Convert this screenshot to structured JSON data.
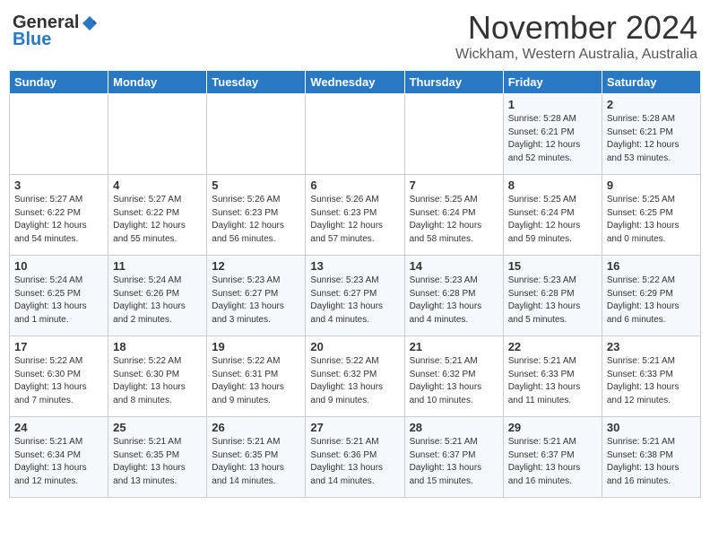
{
  "header": {
    "logo_general": "General",
    "logo_blue": "Blue",
    "title": "November 2024",
    "location": "Wickham, Western Australia, Australia"
  },
  "calendar": {
    "days_of_week": [
      "Sunday",
      "Monday",
      "Tuesday",
      "Wednesday",
      "Thursday",
      "Friday",
      "Saturday"
    ],
    "weeks": [
      [
        {
          "date": "",
          "info": ""
        },
        {
          "date": "",
          "info": ""
        },
        {
          "date": "",
          "info": ""
        },
        {
          "date": "",
          "info": ""
        },
        {
          "date": "",
          "info": ""
        },
        {
          "date": "1",
          "info": "Sunrise: 5:28 AM\nSunset: 6:21 PM\nDaylight: 12 hours\nand 52 minutes."
        },
        {
          "date": "2",
          "info": "Sunrise: 5:28 AM\nSunset: 6:21 PM\nDaylight: 12 hours\nand 53 minutes."
        }
      ],
      [
        {
          "date": "3",
          "info": "Sunrise: 5:27 AM\nSunset: 6:22 PM\nDaylight: 12 hours\nand 54 minutes."
        },
        {
          "date": "4",
          "info": "Sunrise: 5:27 AM\nSunset: 6:22 PM\nDaylight: 12 hours\nand 55 minutes."
        },
        {
          "date": "5",
          "info": "Sunrise: 5:26 AM\nSunset: 6:23 PM\nDaylight: 12 hours\nand 56 minutes."
        },
        {
          "date": "6",
          "info": "Sunrise: 5:26 AM\nSunset: 6:23 PM\nDaylight: 12 hours\nand 57 minutes."
        },
        {
          "date": "7",
          "info": "Sunrise: 5:25 AM\nSunset: 6:24 PM\nDaylight: 12 hours\nand 58 minutes."
        },
        {
          "date": "8",
          "info": "Sunrise: 5:25 AM\nSunset: 6:24 PM\nDaylight: 12 hours\nand 59 minutes."
        },
        {
          "date": "9",
          "info": "Sunrise: 5:25 AM\nSunset: 6:25 PM\nDaylight: 13 hours\nand 0 minutes."
        }
      ],
      [
        {
          "date": "10",
          "info": "Sunrise: 5:24 AM\nSunset: 6:25 PM\nDaylight: 13 hours\nand 1 minute."
        },
        {
          "date": "11",
          "info": "Sunrise: 5:24 AM\nSunset: 6:26 PM\nDaylight: 13 hours\nand 2 minutes."
        },
        {
          "date": "12",
          "info": "Sunrise: 5:23 AM\nSunset: 6:27 PM\nDaylight: 13 hours\nand 3 minutes."
        },
        {
          "date": "13",
          "info": "Sunrise: 5:23 AM\nSunset: 6:27 PM\nDaylight: 13 hours\nand 4 minutes."
        },
        {
          "date": "14",
          "info": "Sunrise: 5:23 AM\nSunset: 6:28 PM\nDaylight: 13 hours\nand 4 minutes."
        },
        {
          "date": "15",
          "info": "Sunrise: 5:23 AM\nSunset: 6:28 PM\nDaylight: 13 hours\nand 5 minutes."
        },
        {
          "date": "16",
          "info": "Sunrise: 5:22 AM\nSunset: 6:29 PM\nDaylight: 13 hours\nand 6 minutes."
        }
      ],
      [
        {
          "date": "17",
          "info": "Sunrise: 5:22 AM\nSunset: 6:30 PM\nDaylight: 13 hours\nand 7 minutes."
        },
        {
          "date": "18",
          "info": "Sunrise: 5:22 AM\nSunset: 6:30 PM\nDaylight: 13 hours\nand 8 minutes."
        },
        {
          "date": "19",
          "info": "Sunrise: 5:22 AM\nSunset: 6:31 PM\nDaylight: 13 hours\nand 9 minutes."
        },
        {
          "date": "20",
          "info": "Sunrise: 5:22 AM\nSunset: 6:32 PM\nDaylight: 13 hours\nand 9 minutes."
        },
        {
          "date": "21",
          "info": "Sunrise: 5:21 AM\nSunset: 6:32 PM\nDaylight: 13 hours\nand 10 minutes."
        },
        {
          "date": "22",
          "info": "Sunrise: 5:21 AM\nSunset: 6:33 PM\nDaylight: 13 hours\nand 11 minutes."
        },
        {
          "date": "23",
          "info": "Sunrise: 5:21 AM\nSunset: 6:33 PM\nDaylight: 13 hours\nand 12 minutes."
        }
      ],
      [
        {
          "date": "24",
          "info": "Sunrise: 5:21 AM\nSunset: 6:34 PM\nDaylight: 13 hours\nand 12 minutes."
        },
        {
          "date": "25",
          "info": "Sunrise: 5:21 AM\nSunset: 6:35 PM\nDaylight: 13 hours\nand 13 minutes."
        },
        {
          "date": "26",
          "info": "Sunrise: 5:21 AM\nSunset: 6:35 PM\nDaylight: 13 hours\nand 14 minutes."
        },
        {
          "date": "27",
          "info": "Sunrise: 5:21 AM\nSunset: 6:36 PM\nDaylight: 13 hours\nand 14 minutes."
        },
        {
          "date": "28",
          "info": "Sunrise: 5:21 AM\nSunset: 6:37 PM\nDaylight: 13 hours\nand 15 minutes."
        },
        {
          "date": "29",
          "info": "Sunrise: 5:21 AM\nSunset: 6:37 PM\nDaylight: 13 hours\nand 16 minutes."
        },
        {
          "date": "30",
          "info": "Sunrise: 5:21 AM\nSunset: 6:38 PM\nDaylight: 13 hours\nand 16 minutes."
        }
      ]
    ]
  }
}
